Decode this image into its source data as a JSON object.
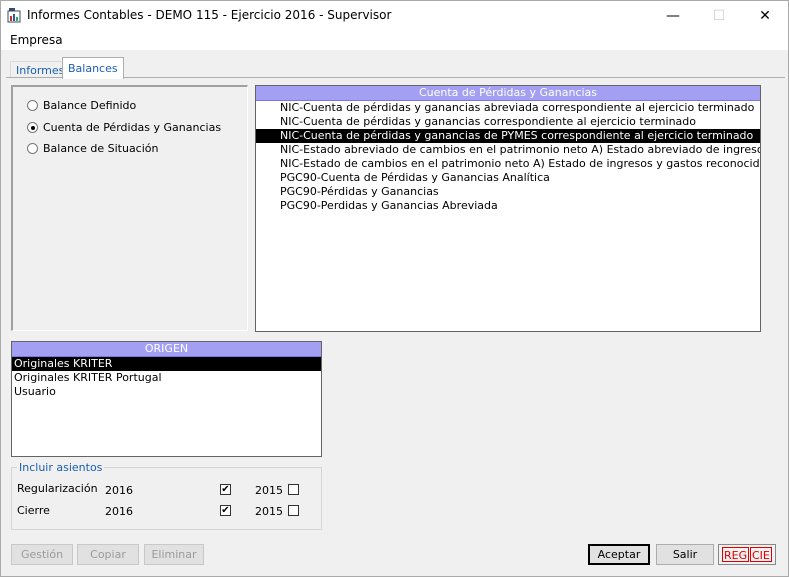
{
  "window": {
    "title": "Informes Contables - DEMO 115 - Ejercicio 2016 - Supervisor",
    "minimize_glyph": "—",
    "maximize_glyph": "☐",
    "close_glyph": "✕"
  },
  "menu": {
    "items": [
      "Empresa"
    ]
  },
  "tabs": [
    {
      "label": "Informes",
      "active": false
    },
    {
      "label": "Balances",
      "active": true
    }
  ],
  "balance_type": {
    "options": [
      {
        "label": "Balance Definido",
        "checked": false
      },
      {
        "label": "Cuenta de Pérdidas y Ganancias",
        "checked": true
      },
      {
        "label": "Balance de Situación",
        "checked": false
      }
    ]
  },
  "report_list": {
    "header": "Cuenta de Pérdidas y Ganancias",
    "items": [
      {
        "label": "NIC-Cuenta de pérdidas y ganancias abreviada correspondiente al ejercicio terminado",
        "selected": false
      },
      {
        "label": "NIC-Cuenta de pérdidas y ganancias correspondiente al ejercicio terminado",
        "selected": false
      },
      {
        "label": "NIC-Cuenta de pérdidas y ganancias de PYMES correspondiente al ejercicio terminado",
        "selected": true
      },
      {
        "label": "NIC-Estado abreviado de cambios en el patrimonio neto A) Estado abreviado de ingresos y gastos rec",
        "selected": false
      },
      {
        "label": "NIC-Estado de cambios en el patrimonio neto A) Estado de ingresos y gastos reconocidos",
        "selected": false
      },
      {
        "label": "PGC90-Cuenta de Pérdidas y Ganancias Analítica",
        "selected": false
      },
      {
        "label": "PGC90-Pérdidas y Ganancias",
        "selected": false
      },
      {
        "label": "PGC90-Perdidas y Ganancias Abreviada",
        "selected": false
      }
    ]
  },
  "origin_list": {
    "header": "ORIGEN",
    "items": [
      {
        "label": "Originales KRITER",
        "selected": true
      },
      {
        "label": "Originales KRITER Portugal",
        "selected": false
      },
      {
        "label": "Usuario",
        "selected": false
      }
    ]
  },
  "include_entries": {
    "title": "Incluir asientos",
    "rows": [
      {
        "label": "Regularización",
        "year1": "2016",
        "year1_checked": true,
        "year2": "2015",
        "year2_checked": false
      },
      {
        "label": "Cierre",
        "year1": "2016",
        "year1_checked": true,
        "year2": "2015",
        "year2_checked": false
      }
    ]
  },
  "buttons": {
    "gestion": {
      "label": "Gestión",
      "enabled": false
    },
    "copiar": {
      "label": "Copiar",
      "enabled": false
    },
    "eliminar": {
      "label": "Eliminar",
      "enabled": false
    },
    "aceptar": {
      "label": "Aceptar",
      "enabled": true
    },
    "salir": {
      "label": "Salir",
      "enabled": true
    }
  },
  "status": {
    "reg": "REG",
    "cie": "CIE",
    "color": "#dd0000"
  },
  "colors": {
    "list_header": "#a3a0f4",
    "link_blue": "#1b5fae",
    "selection": "#000000"
  }
}
